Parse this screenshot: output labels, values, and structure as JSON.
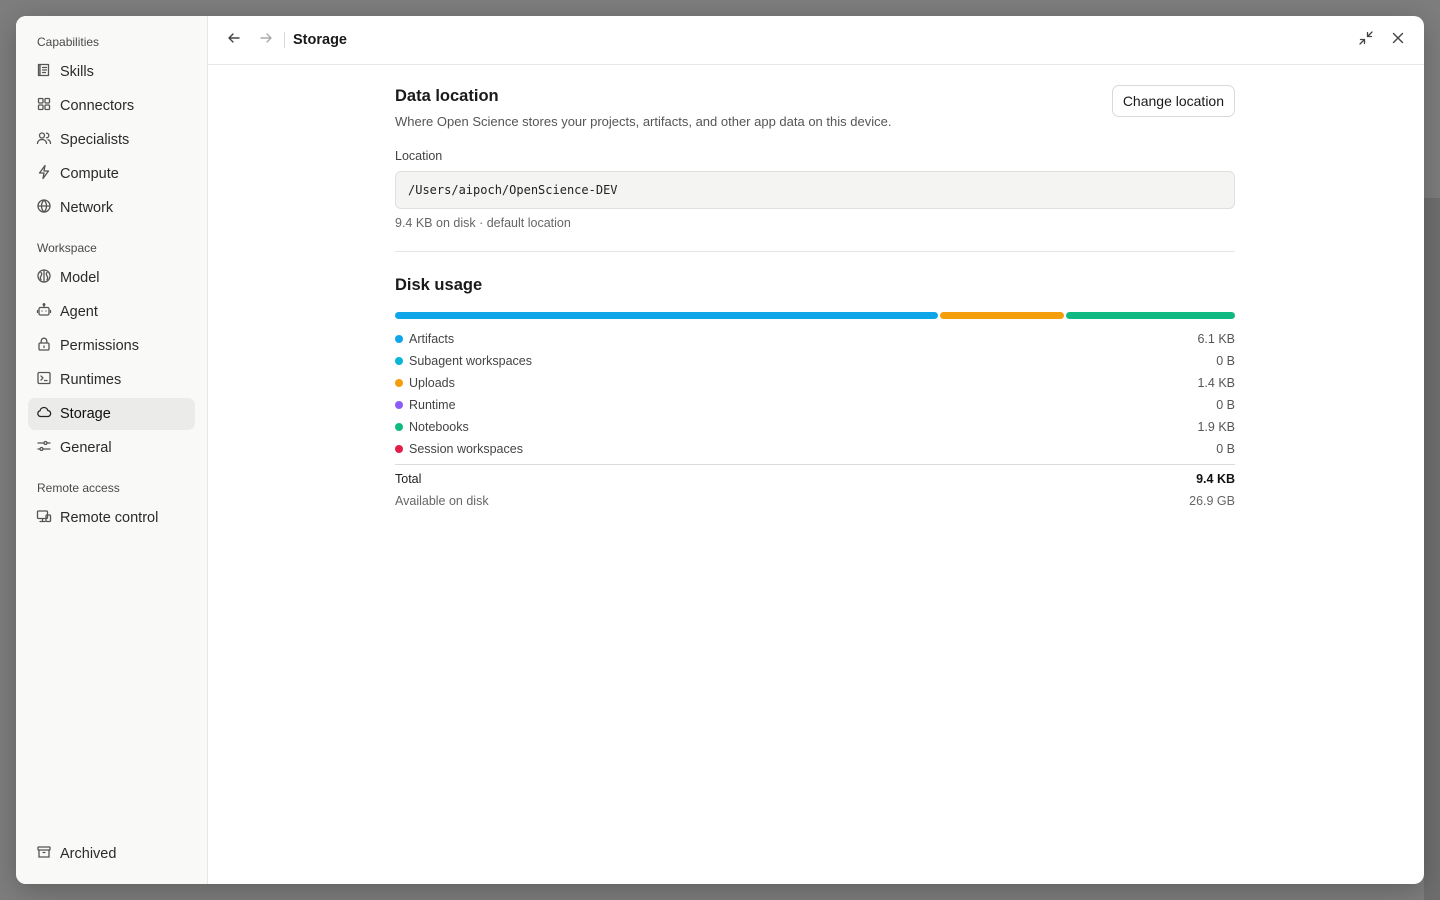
{
  "sidebar": {
    "sections": [
      {
        "title": "Capabilities",
        "items": [
          {
            "label": "Skills",
            "icon": "skills-icon"
          },
          {
            "label": "Connectors",
            "icon": "connectors-icon"
          },
          {
            "label": "Specialists",
            "icon": "specialists-icon"
          },
          {
            "label": "Compute",
            "icon": "compute-icon"
          },
          {
            "label": "Network",
            "icon": "network-icon"
          }
        ]
      },
      {
        "title": "Workspace",
        "items": [
          {
            "label": "Model",
            "icon": "model-icon"
          },
          {
            "label": "Agent",
            "icon": "agent-icon"
          },
          {
            "label": "Permissions",
            "icon": "lock-icon"
          },
          {
            "label": "Runtimes",
            "icon": "terminal-icon"
          },
          {
            "label": "Storage",
            "icon": "cloud-icon",
            "active": true
          },
          {
            "label": "General",
            "icon": "sliders-icon"
          }
        ]
      },
      {
        "title": "Remote access",
        "items": [
          {
            "label": "Remote control",
            "icon": "remote-control-icon"
          }
        ]
      }
    ],
    "bottom_item": {
      "label": "Archived",
      "icon": "archive-icon"
    }
  },
  "topbar": {
    "title": "Storage",
    "icons": [
      "back-arrow-icon",
      "forward-arrow-icon",
      "minimize-icon",
      "close-icon"
    ]
  },
  "data_location": {
    "heading": "Data location",
    "description": "Where Open Science stores your projects, artifacts, and other app data on this device.",
    "change_button": "Change location",
    "location_label": "Location",
    "path": "/Users/aipoch/OpenScience-DEV",
    "meta": "9.4 KB on disk · default location"
  },
  "disk_usage": {
    "heading": "Disk usage",
    "bar_fractions": [
      {
        "category": "Artifacts",
        "fraction": 0.649,
        "color": "#0ea5e9"
      },
      {
        "category": "Uploads",
        "fraction": 0.149,
        "color": "#f59e0b"
      },
      {
        "category": "Notebooks",
        "fraction": 0.202,
        "color": "#10b981"
      }
    ],
    "rows": [
      {
        "label": "Artifacts",
        "value": "6.1 KB",
        "color": "#0ea5e9"
      },
      {
        "label": "Subagent workspaces",
        "value": "0 B",
        "color": "#06b6d4"
      },
      {
        "label": "Uploads",
        "value": "1.4 KB",
        "color": "#f59e0b"
      },
      {
        "label": "Runtime",
        "value": "0 B",
        "color": "#8b5cf6"
      },
      {
        "label": "Notebooks",
        "value": "1.9 KB",
        "color": "#10b981"
      },
      {
        "label": "Session workspaces",
        "value": "0 B",
        "color": "#e11d48"
      }
    ],
    "total_label": "Total",
    "total_value": "9.4 KB",
    "available_label": "Available on disk",
    "available_value": "26.9 GB"
  }
}
